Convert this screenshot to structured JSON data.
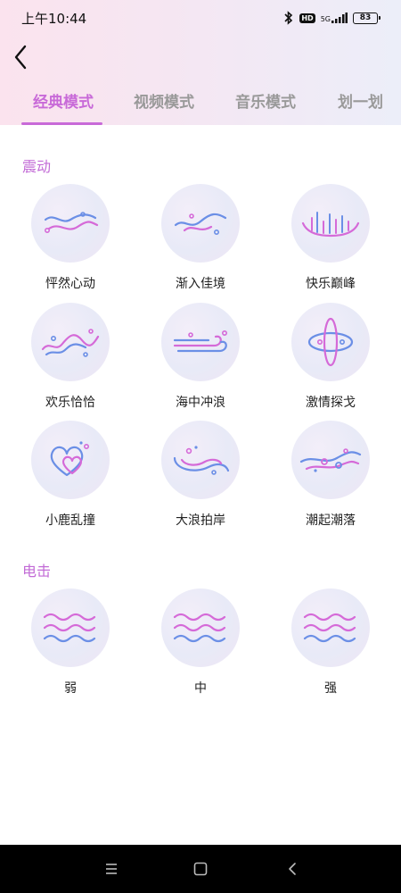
{
  "status": {
    "time": "上午10:44",
    "hd": "HD",
    "network": "5G",
    "battery": "83"
  },
  "tabs": [
    {
      "label": "经典模式",
      "active": true
    },
    {
      "label": "视频模式",
      "active": false
    },
    {
      "label": "音乐模式",
      "active": false
    },
    {
      "label": "划一划",
      "active": false
    }
  ],
  "vibration": {
    "title": "震动",
    "items": [
      {
        "label": "怦然心动",
        "icon": "wave-heartbeat-icon"
      },
      {
        "label": "渐入佳境",
        "icon": "wave-gradual-icon"
      },
      {
        "label": "快乐巅峰",
        "icon": "peak-bars-icon"
      },
      {
        "label": "欢乐恰恰",
        "icon": "wave-dance-icon"
      },
      {
        "label": "海中冲浪",
        "icon": "wind-surf-icon"
      },
      {
        "label": "激情探戈",
        "icon": "orbit-icon"
      },
      {
        "label": "小鹿乱撞",
        "icon": "heart-icon"
      },
      {
        "label": "大浪拍岸",
        "icon": "big-wave-icon"
      },
      {
        "label": "潮起潮落",
        "icon": "tide-icon"
      }
    ]
  },
  "shock": {
    "title": "电击",
    "items": [
      {
        "label": "弱",
        "icon": "triple-wave-icon"
      },
      {
        "label": "中",
        "icon": "triple-wave-icon"
      },
      {
        "label": "强",
        "icon": "triple-wave-icon"
      }
    ]
  },
  "colors": {
    "accent": "#c86ad8",
    "wave_pink": "#d56ad8",
    "wave_blue": "#6b8fe6"
  }
}
